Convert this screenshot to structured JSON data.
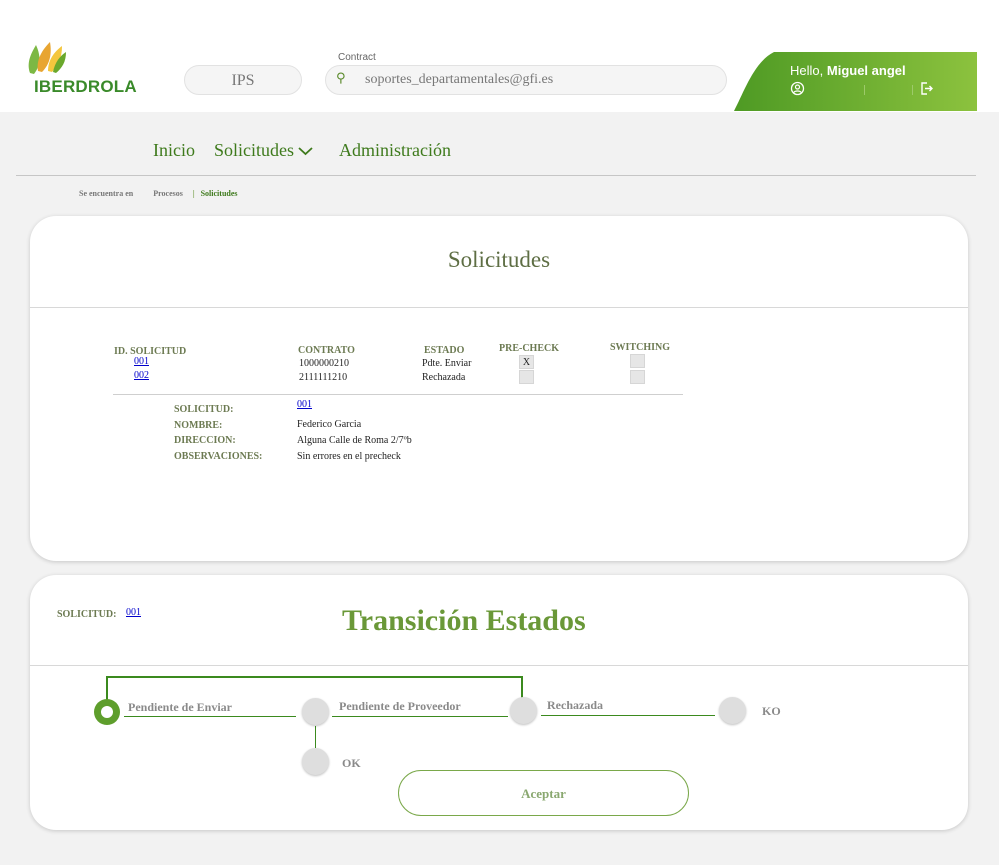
{
  "header": {
    "logo_text": "IBERDROLA",
    "system_pill": "IPS",
    "contract_label": "Contract",
    "contract_value": "soportes_departamentales@gfi.es",
    "greeting": "Hello,",
    "user_name": "Miguel angel"
  },
  "nav": {
    "items": [
      {
        "label": "Inicio"
      },
      {
        "label": "Solicitudes"
      },
      {
        "label": "Administración"
      }
    ]
  },
  "breadcrumb": {
    "prefix": "Se encuentra en",
    "level1": "Procesos",
    "separator": "|",
    "current": "Solicitudes"
  },
  "solicitudes_card": {
    "title": "Solicitudes",
    "columns": {
      "id": "ID. SOLICITUD",
      "contrato": "CONTRATO",
      "estado": "ESTADO",
      "precheck": "PRE-CHECK",
      "switching": "SWITCHING"
    },
    "rows": [
      {
        "id": "001",
        "contrato": "1000000210",
        "estado": "Pdte. Enviar",
        "precheck": "X",
        "switching": ""
      },
      {
        "id": "002",
        "contrato": "2111111210",
        "estado": "Rechazada",
        "precheck": "",
        "switching": ""
      }
    ],
    "detail": {
      "solicitud_label": "SOLICITUD:",
      "solicitud_value": "001",
      "nombre_label": "NOMBRE:",
      "nombre_value": "Federico Garcia",
      "direccion_label": "DIRECCION:",
      "direccion_value": "Alguna Calle de Roma 2/7ºb",
      "observaciones_label": "OBSERVACIONES:",
      "observaciones_value": "Sin errores en el precheck"
    }
  },
  "transicion_card": {
    "solicitud_label": "SOLICITUD:",
    "solicitud_value": "001",
    "title": "Transición Estados",
    "states": [
      {
        "label": "Pendiente de Enviar",
        "active": true
      },
      {
        "label": "Pendiente de Proveedor",
        "active": false
      },
      {
        "label": "Rechazada",
        "active": false
      },
      {
        "label": "KO",
        "active": false
      },
      {
        "label": "OK",
        "active": false
      }
    ],
    "accept_label": "Aceptar"
  },
  "colors": {
    "brand_green": "#3e7a1c",
    "accent_green": "#6a9838",
    "line_green": "#3b8a1e",
    "user_panel_green": "#6aa82c"
  }
}
